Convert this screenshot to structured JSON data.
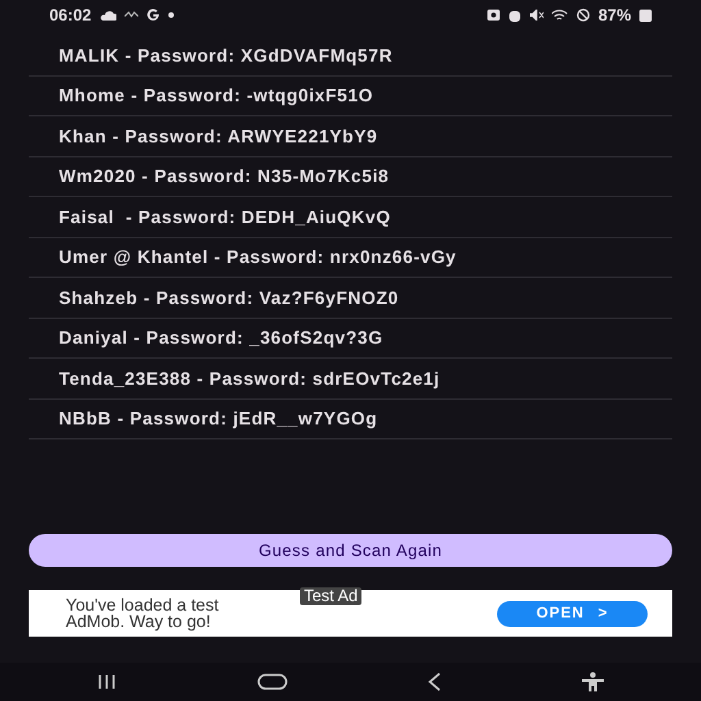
{
  "status_bar": {
    "time": "06:02",
    "battery": "87%"
  },
  "networks": [
    {
      "text": "MALIK - Password: XGdDVAFMq57R"
    },
    {
      "text": "Mhome - Password: -wtqg0ixF51O"
    },
    {
      "text": "Khan - Password: ARWYE221YbY9"
    },
    {
      "text": "Wm2020 - Password: N35-Mo7Kc5i8"
    },
    {
      "text": "Faisal  - Password: DEDH_AiuQKvQ"
    },
    {
      "text": "Umer @ Khantel - Password: nrx0nz66-vGy"
    },
    {
      "text": "Shahzeb - Password: Vaz?F6yFNOZ0"
    },
    {
      "text": "Daniyal - Password: _36ofS2qv?3G"
    },
    {
      "text": "Tenda_23E388 - Password: sdrEOvTc2e1j"
    },
    {
      "text": "NBbB - Password: jEdR__w7YGOg"
    }
  ],
  "action_button": "Guess and Scan Again",
  "ad": {
    "badge": "Test Ad",
    "lines": [
      "You've loaded a test",
      "AdMob. Way to go!"
    ],
    "button": "OPEN",
    "button_icon": ">"
  }
}
